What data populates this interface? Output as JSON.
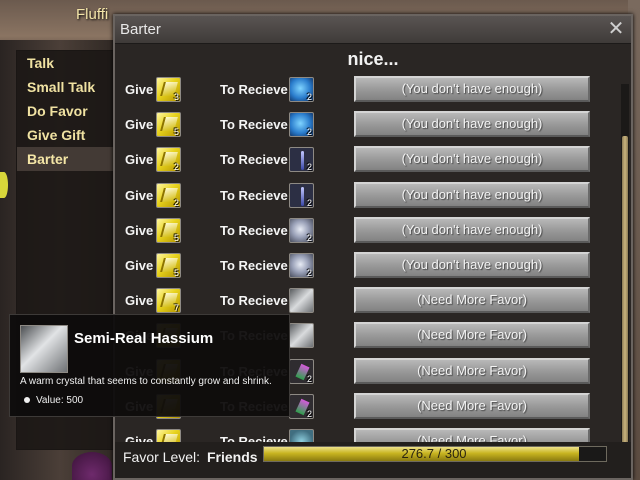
{
  "scene": {
    "npc_name": "Fluffi"
  },
  "menu": {
    "items": [
      {
        "label": "Talk",
        "active": false
      },
      {
        "label": "Small Talk",
        "active": false
      },
      {
        "label": "Do Favor",
        "active": false
      },
      {
        "label": "Give Gift",
        "active": false
      },
      {
        "label": "Barter",
        "active": true
      }
    ]
  },
  "window": {
    "title": "Barter",
    "close_glyph": "✕",
    "heading": "nice...",
    "give_label": "Give",
    "receive_label": "To Recieve"
  },
  "rows": [
    {
      "give_qty": "3",
      "give_icon": "gold-leaf-icon",
      "receive_qty": "2",
      "receive_icon": "blue-crystal-icon",
      "receive_style": "blue",
      "action": "(You don't have enough)"
    },
    {
      "give_qty": "5",
      "give_icon": "gold-leaf-icon",
      "receive_qty": "2",
      "receive_icon": "blue-crystal-icon",
      "receive_style": "blue",
      "action": "(You don't have enough)"
    },
    {
      "give_qty": "2",
      "give_icon": "gold-leaf-icon",
      "receive_qty": "2",
      "receive_icon": "blue-rod-icon",
      "receive_style": "rod",
      "action": "(You don't have enough)"
    },
    {
      "give_qty": "2",
      "give_icon": "gold-leaf-icon",
      "receive_qty": "2",
      "receive_icon": "blue-rod-icon",
      "receive_style": "rod",
      "action": "(You don't have enough)"
    },
    {
      "give_qty": "5",
      "give_icon": "gold-leaf-icon",
      "receive_qty": "2",
      "receive_icon": "silver-orb-icon",
      "receive_style": "orb",
      "action": "(You don't have enough)"
    },
    {
      "give_qty": "5",
      "give_icon": "gold-leaf-icon",
      "receive_qty": "2",
      "receive_icon": "silver-orb-icon",
      "receive_style": "orb",
      "action": "(You don't have enough)"
    },
    {
      "give_qty": "7",
      "give_icon": "gold-leaf-icon",
      "receive_qty": "",
      "receive_icon": "hassium-crystal-icon",
      "receive_style": "crystal",
      "action": "(Need More Favor)"
    },
    {
      "give_qty": "",
      "give_icon": "gold-leaf-icon",
      "receive_qty": "",
      "receive_icon": "hassium-crystal-icon",
      "receive_style": "crystal",
      "action": "(Need More Favor)"
    },
    {
      "give_qty": "",
      "give_icon": "gold-leaf-icon",
      "receive_qty": "2",
      "receive_icon": "green-gem-icon",
      "receive_style": "gem",
      "action": "(Need More Favor)"
    },
    {
      "give_qty": "",
      "give_icon": "gold-leaf-icon",
      "receive_qty": "2",
      "receive_icon": "green-gem-icon",
      "receive_style": "gem",
      "action": "(Need More Favor)"
    },
    {
      "give_qty": "",
      "give_icon": "gold-leaf-icon",
      "receive_qty": "",
      "receive_icon": "wand-icon",
      "receive_style": "wand",
      "action": "(Need More Favor)"
    }
  ],
  "favor": {
    "label": "Favor Level:",
    "level": "Friends",
    "text": "276.7 / 300",
    "current": 276.7,
    "max": 300
  },
  "tooltip": {
    "icon": "hassium-crystal-icon",
    "name": "Semi-Real Hassium",
    "description": "A warm crystal that seems to constantly grow and shrink.",
    "value_label": "Value: 500"
  }
}
